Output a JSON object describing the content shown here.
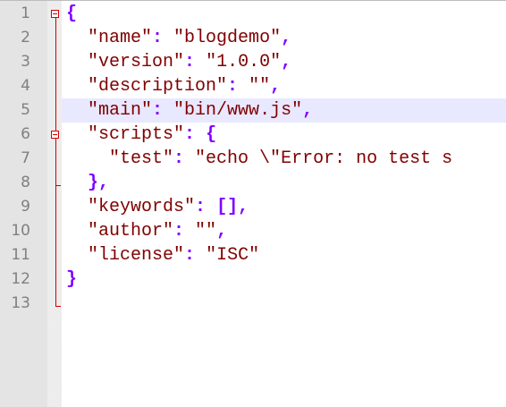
{
  "editor": {
    "current_line": 5,
    "lines": [
      {
        "number": "1",
        "indent": "",
        "key": "",
        "value": "",
        "open": "{",
        "suffix": ""
      },
      {
        "number": "2",
        "indent": "  ",
        "key": "\"name\"",
        "colon": ": ",
        "value": "\"blogdemo\"",
        "suffix": ","
      },
      {
        "number": "3",
        "indent": "  ",
        "key": "\"version\"",
        "colon": ": ",
        "value": "\"1.0.0\"",
        "suffix": ","
      },
      {
        "number": "4",
        "indent": "  ",
        "key": "\"description\"",
        "colon": ": ",
        "value": "\"\"",
        "suffix": ","
      },
      {
        "number": "5",
        "indent": "  ",
        "key": "\"main\"",
        "colon": ": ",
        "value": "\"bin/www.js\"",
        "suffix": ","
      },
      {
        "number": "6",
        "indent": "  ",
        "key": "\"scripts\"",
        "colon": ": ",
        "value": "",
        "open": "{",
        "suffix": ""
      },
      {
        "number": "7",
        "indent": "    ",
        "key": "\"test\"",
        "colon": ": ",
        "value": "\"echo \\\"Error: no test s",
        "suffix": ""
      },
      {
        "number": "8",
        "indent": "  ",
        "key": "",
        "value": "",
        "open": "}",
        "suffix": ","
      },
      {
        "number": "9",
        "indent": "  ",
        "key": "\"keywords\"",
        "colon": ": ",
        "value": "",
        "open": "[]",
        "suffix": ","
      },
      {
        "number": "10",
        "indent": "  ",
        "key": "\"author\"",
        "colon": ": ",
        "value": "\"\"",
        "suffix": ","
      },
      {
        "number": "11",
        "indent": "  ",
        "key": "\"license\"",
        "colon": ": ",
        "value": "\"ISC\"",
        "suffix": ""
      },
      {
        "number": "12",
        "indent": "",
        "key": "",
        "value": "",
        "open": "}",
        "suffix": ""
      },
      {
        "number": "13",
        "indent": "",
        "key": "",
        "value": "",
        "open": "",
        "suffix": ""
      }
    ]
  },
  "colors": {
    "key": "#800000",
    "string": "#800000",
    "punctuation": "#8000ff",
    "line_number": "#808080",
    "gutter": "#e4e4e4",
    "current_line": "#e8e8ff",
    "fold_marker": "#d00000"
  }
}
